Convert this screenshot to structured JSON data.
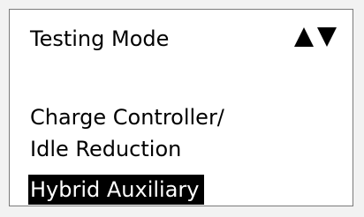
{
  "screen": {
    "title": "Testing Mode",
    "nav": {
      "up_icon": "triangle-up-icon",
      "down_icon": "triangle-down-icon"
    },
    "menu": {
      "items": [
        {
          "label": "Charge Controller/"
        },
        {
          "label": "Idle Reduction"
        },
        {
          "label": "Hybrid Auxiliary",
          "selected": true
        }
      ]
    }
  },
  "colors": {
    "background": "#ffffff",
    "text": "#000000",
    "highlight_bg": "#000000",
    "highlight_text": "#ffffff"
  }
}
